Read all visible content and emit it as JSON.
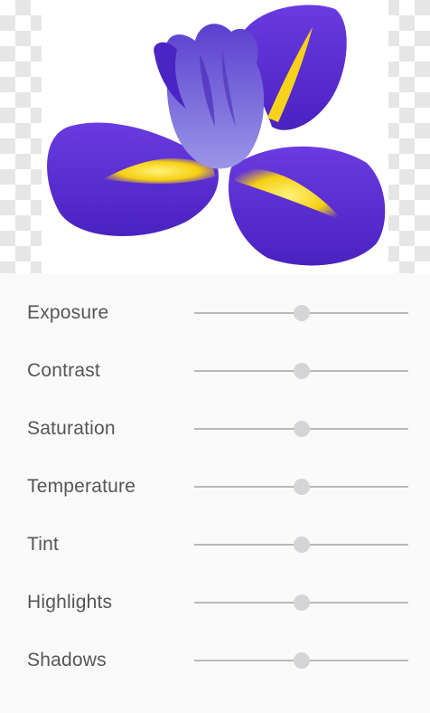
{
  "preview": {
    "image_subject": "purple iris flower",
    "checkerboard_colors": [
      "#ffffff",
      "#e6e6e6"
    ],
    "flower_colors": {
      "petal": "#5b2fd1",
      "petal_dark": "#3f1fa6",
      "center": "#7d74d6",
      "beard": "#f7d21a"
    }
  },
  "adjustments": [
    {
      "label": "Exposure",
      "value": 0.5
    },
    {
      "label": "Contrast",
      "value": 0.5
    },
    {
      "label": "Saturation",
      "value": 0.5
    },
    {
      "label": "Temperature",
      "value": 0.5
    },
    {
      "label": "Tint",
      "value": 0.5
    },
    {
      "label": "Highlights",
      "value": 0.5
    },
    {
      "label": "Shadows",
      "value": 0.5
    }
  ]
}
